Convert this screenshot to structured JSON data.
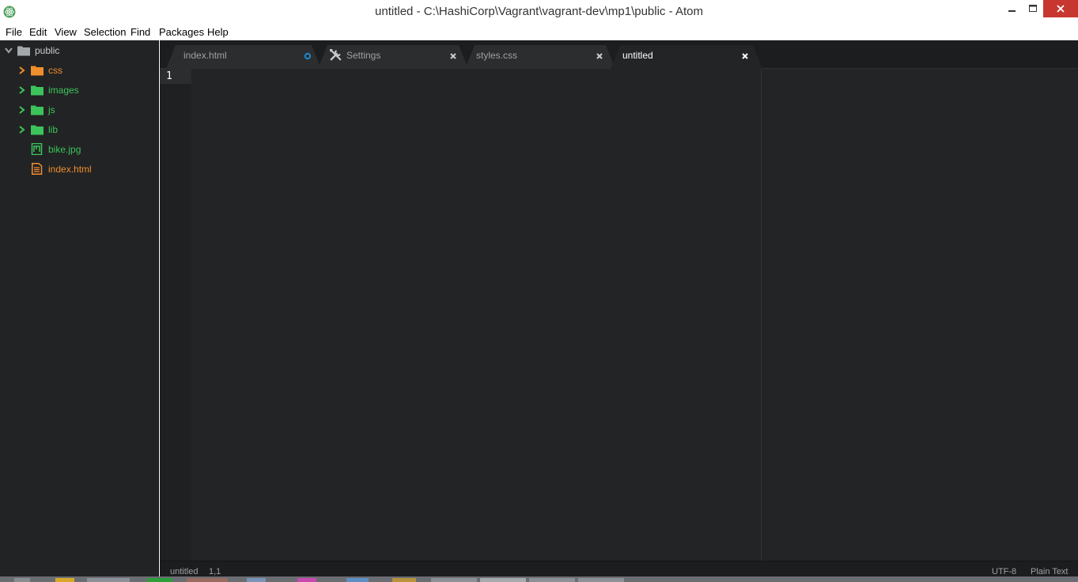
{
  "window": {
    "title": "untitled - C:\\HashiCorp\\Vagrant\\vagrant-dev\\mp1\\public - Atom",
    "app_icon": "atom-icon"
  },
  "menu": [
    "File",
    "Edit",
    "View",
    "Selection",
    "Find",
    "Packages",
    "Help"
  ],
  "tree": {
    "root": "public",
    "items": [
      {
        "label": "css",
        "type": "folder",
        "color": "#f08d2e"
      },
      {
        "label": "images",
        "type": "folder",
        "color": "#3cc45b"
      },
      {
        "label": "js",
        "type": "folder",
        "color": "#3cc45b"
      },
      {
        "label": "lib",
        "type": "folder",
        "color": "#3cc45b"
      },
      {
        "label": "bike.jpg",
        "type": "file-image",
        "color": "#3cc45b"
      },
      {
        "label": "index.html",
        "type": "file-code",
        "color": "#f08d2e"
      }
    ]
  },
  "tabs": [
    {
      "label": "index.html",
      "modified": true,
      "active": false
    },
    {
      "label": "Settings",
      "icon": "tools-icon",
      "active": false
    },
    {
      "label": "styles.css",
      "active": false
    },
    {
      "label": "untitled",
      "active": true
    }
  ],
  "editor": {
    "line_numbers": [
      "1"
    ]
  },
  "status": {
    "file": "untitled",
    "cursor": "1,1",
    "encoding": "UTF-8",
    "grammar": "Plain Text"
  },
  "colors": {
    "accent_blue": "#1e90e0",
    "folder_orange": "#f08d2e",
    "folder_green": "#3cc45b",
    "close_red": "#c7372f"
  }
}
